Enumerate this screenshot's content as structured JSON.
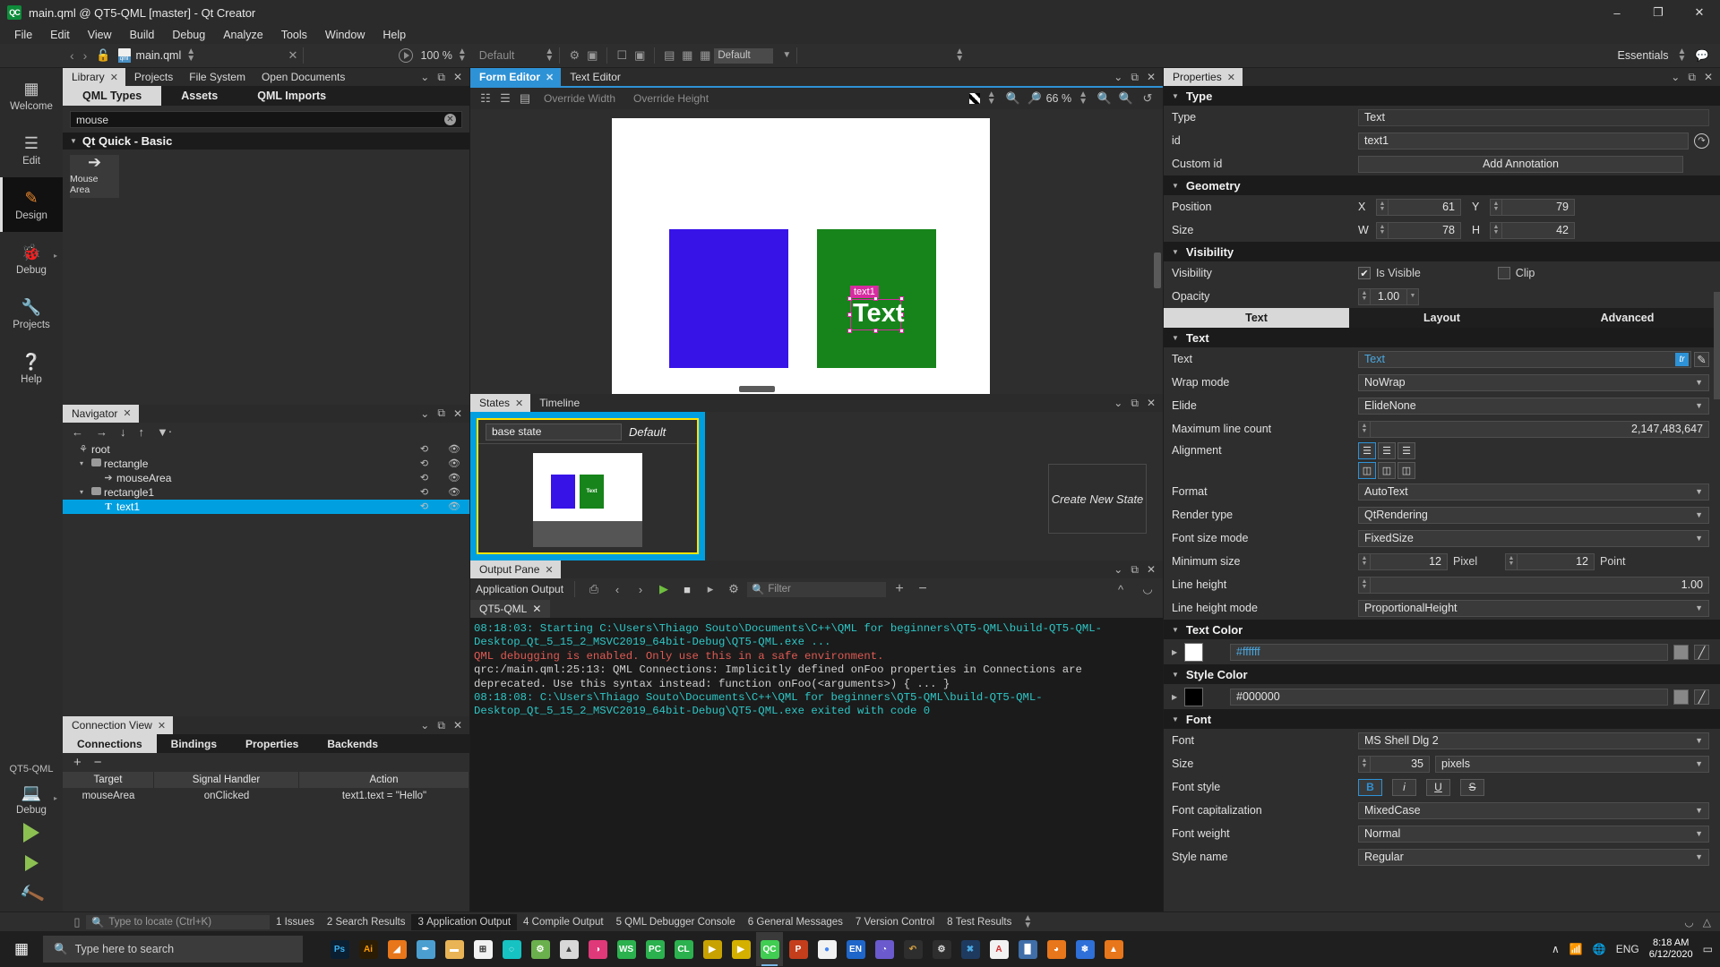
{
  "window": {
    "title": "main.qml @ QT5-QML [master] - Qt Creator",
    "app_icon": "qt-creator-icon",
    "minimize": "–",
    "maximize": "❐",
    "close": "✕"
  },
  "menubar": {
    "items": [
      "File",
      "Edit",
      "View",
      "Build",
      "Debug",
      "Analyze",
      "Tools",
      "Window",
      "Help"
    ]
  },
  "toolbar": {
    "back": "‹",
    "forward": "›",
    "lock": "lock-open-icon",
    "filename": "main.qml",
    "close_doc": "✕",
    "run_percent": "100 %",
    "preview_default": "Default",
    "kit_default": "Default",
    "essentials": "Essentials"
  },
  "modebar": {
    "modes": [
      {
        "label": "Welcome",
        "icon": "▒",
        "active": false
      },
      {
        "label": "Edit",
        "icon": "☰",
        "active": false
      },
      {
        "label": "Design",
        "icon": "✎",
        "active": true
      },
      {
        "label": "Debug",
        "icon": "🐞",
        "active": false,
        "arrow": "▸"
      },
      {
        "label": "Projects",
        "icon": "🔧",
        "active": false
      },
      {
        "label": "Help",
        "icon": "?",
        "active": false
      }
    ],
    "kit_name": "QT5-QML",
    "build_config": "Debug",
    "build_arrow": "▸"
  },
  "library": {
    "dock_tabs": [
      {
        "label": "Library",
        "selected": true,
        "closable": true
      },
      {
        "label": "Projects",
        "selected": false
      },
      {
        "label": "File System",
        "selected": false
      },
      {
        "label": "Open Documents",
        "selected": false
      }
    ],
    "sub_tabs": [
      {
        "label": "QML Types",
        "selected": true
      },
      {
        "label": "Assets",
        "selected": false
      },
      {
        "label": "QML Imports",
        "selected": false
      }
    ],
    "search_value": "mouse",
    "clear_icon": "✕",
    "group_label": "Qt Quick - Basic",
    "items": [
      {
        "label": "Mouse Area",
        "icon": "cursor-arrow-icon"
      }
    ]
  },
  "navigator": {
    "title": "Navigator",
    "toolbar_icons": [
      "←",
      "→",
      "↓",
      "↑",
      "filter-icon"
    ],
    "rows": [
      {
        "name": "root",
        "indent": 0,
        "twisty": "",
        "icon": "component-icon",
        "selected": false
      },
      {
        "name": "rectangle",
        "indent": 1,
        "twisty": "▾",
        "icon": "rectangle-icon",
        "selected": false
      },
      {
        "name": "mouseArea",
        "indent": 2,
        "twisty": "",
        "icon": "cursor-arrow-icon",
        "selected": false
      },
      {
        "name": "rectangle1",
        "indent": 1,
        "twisty": "▾",
        "icon": "rectangle-icon",
        "selected": false
      },
      {
        "name": "text1",
        "indent": 2,
        "twisty": "",
        "icon": "text-T-icon",
        "selected": true
      }
    ]
  },
  "connection_view": {
    "title": "Connection View",
    "tabs": [
      {
        "label": "Connections",
        "selected": true
      },
      {
        "label": "Bindings",
        "selected": false
      },
      {
        "label": "Properties",
        "selected": false
      },
      {
        "label": "Backends",
        "selected": false
      }
    ],
    "add_icon": "+",
    "remove_icon": "−",
    "columns": [
      "Target",
      "Signal Handler",
      "Action"
    ],
    "rows": [
      {
        "target": "mouseArea",
        "signal_handler": "onClicked",
        "action": "text1.text = \"Hello\""
      }
    ]
  },
  "form_editor": {
    "tabs": [
      {
        "label": "Form Editor",
        "selected": true,
        "closable": true
      },
      {
        "label": "Text Editor",
        "selected": false
      }
    ],
    "override_width": "Override Width",
    "override_height": "Override Height",
    "zoom": "66 %",
    "canvas": {
      "blue_rect": "rectangle",
      "green_rect": "rectangle1",
      "selected_label": "text1",
      "text_value": "Text"
    }
  },
  "states": {
    "tabs": [
      {
        "label": "States",
        "selected": true,
        "closable": true
      },
      {
        "label": "Timeline",
        "selected": false
      }
    ],
    "state_name": "base state",
    "default_label": "Default",
    "create_new": "Create New State"
  },
  "output": {
    "title": "Output Pane",
    "pane_name": "Application Output",
    "filter_placeholder": "Filter",
    "run_tab": "QT5-QML",
    "lines": [
      {
        "color": "cyan",
        "text": "08:18:03: Starting C:\\Users\\Thiago Souto\\Documents\\C++\\QML for beginners\\QT5-QML\\build-QT5-QML-Desktop_Qt_5_15_2_MSVC2019_64bit-Debug\\QT5-QML.exe ..."
      },
      {
        "color": "red",
        "text": "QML debugging is enabled. Only use this in a safe environment."
      },
      {
        "color": "gray",
        "text": "qrc:/main.qml:25:13: QML Connections: Implicitly defined onFoo properties in Connections are deprecated. Use this syntax instead: function onFoo(<arguments>) { ... }"
      },
      {
        "color": "cyan",
        "text": "08:18:08: C:\\Users\\Thiago Souto\\Documents\\C++\\QML for beginners\\QT5-QML\\build-QT5-QML-Desktop_Qt_5_15_2_MSVC2019_64bit-Debug\\QT5-QML.exe exited with code 0"
      }
    ]
  },
  "properties": {
    "title": "Properties",
    "sections": {
      "type": {
        "header": "Type",
        "type_label": "Type",
        "type_value": "Text",
        "id_label": "id",
        "id_value": "text1",
        "custom_id_label": "Custom id",
        "add_annotation": "Add Annotation",
        "reset_icon": "reset-icon"
      },
      "geometry": {
        "header": "Geometry",
        "position_label": "Position",
        "x_label": "X",
        "x_value": "61",
        "y_label": "Y",
        "y_value": "79",
        "size_label": "Size",
        "w_label": "W",
        "w_value": "78",
        "h_label": "H",
        "h_value": "42"
      },
      "visibility": {
        "header": "Visibility",
        "visibility_label": "Visibility",
        "is_visible_label": "Is Visible",
        "is_visible_checked": "✔",
        "clip_label": "Clip",
        "clip_checked": "",
        "opacity_label": "Opacity",
        "opacity_value": "1.00"
      },
      "tabs": [
        {
          "label": "Text",
          "selected": true
        },
        {
          "label": "Layout",
          "selected": false
        },
        {
          "label": "Advanced",
          "selected": false
        }
      ],
      "text": {
        "header": "Text",
        "text_label": "Text",
        "text_value": "Text",
        "tr_badge": "tr",
        "edit_icon": "edit-icon",
        "wrap_label": "Wrap mode",
        "wrap_value": "NoWrap",
        "elide_label": "Elide",
        "elide_value": "ElideNone",
        "maxlines_label": "Maximum line count",
        "maxlines_value": "2,147,483,647",
        "alignment_label": "Alignment",
        "align_h": [
          "align-left-icon",
          "align-center-icon",
          "align-right-icon"
        ],
        "align_v": [
          "align-top-icon",
          "align-middle-icon",
          "align-bottom-icon"
        ],
        "format_label": "Format",
        "format_value": "AutoText",
        "render_label": "Render type",
        "render_value": "QtRendering",
        "fontsizemode_label": "Font size mode",
        "fontsizemode_value": "FixedSize",
        "minsize_label": "Minimum size",
        "minsize_px": "12",
        "px_unit": "Pixel",
        "minsize_pt": "12",
        "pt_unit": "Point",
        "lineheight_label": "Line height",
        "lineheight_value": "1.00",
        "lineheightmode_label": "Line height mode",
        "lineheightmode_value": "ProportionalHeight"
      },
      "text_color": {
        "header": "Text Color",
        "value": "#ffffff",
        "swatch": "#ffffff"
      },
      "style_color": {
        "header": "Style Color",
        "value": "#000000",
        "swatch": "#000000"
      },
      "font": {
        "header": "Font",
        "font_label": "Font",
        "font_value": "MS Shell Dlg 2",
        "size_label": "Size",
        "size_value": "35",
        "size_unit": "pixels",
        "fontstyle_label": "Font style",
        "style_buttons": [
          {
            "glyph": "B",
            "active": true
          },
          {
            "glyph": "i",
            "active": false
          },
          {
            "glyph": "U",
            "active": false
          },
          {
            "glyph": "S",
            "active": false
          }
        ],
        "capitalization_label": "Font capitalization",
        "capitalization_value": "MixedCase",
        "weight_label": "Font weight",
        "weight_value": "Normal",
        "stylename_label": "Style name",
        "stylename_value": "Regular"
      }
    }
  },
  "statusbar": {
    "locate_placeholder": "Type to locate (Ctrl+K)",
    "panes": [
      {
        "num": "1",
        "label": "Issues",
        "selected": false
      },
      {
        "num": "2",
        "label": "Search Results",
        "selected": false
      },
      {
        "num": "3",
        "label": "Application Output",
        "selected": true
      },
      {
        "num": "4",
        "label": "Compile Output",
        "selected": false
      },
      {
        "num": "5",
        "label": "QML Debugger Console",
        "selected": false
      },
      {
        "num": "6",
        "label": "General Messages",
        "selected": false
      },
      {
        "num": "7",
        "label": "Version Control",
        "selected": false
      },
      {
        "num": "8",
        "label": "Test Results",
        "selected": false
      }
    ]
  },
  "taskbar": {
    "search_placeholder": "Type here to search",
    "apps": [
      {
        "name": "photoshop",
        "glyph": "Ps",
        "bg": "#0b1f33",
        "fg": "#3ab0f0",
        "active": false
      },
      {
        "name": "illustrator",
        "glyph": "Ai",
        "bg": "#2b1d05",
        "fg": "#ff9a00",
        "active": false
      },
      {
        "name": "blender",
        "glyph": "◢",
        "bg": "#e8761a",
        "fg": "#fff",
        "active": false
      },
      {
        "name": "knife",
        "glyph": "✒",
        "bg": "#4b9fd0",
        "fg": "#fff",
        "active": false
      },
      {
        "name": "explorer",
        "glyph": "▬",
        "bg": "#e8b455",
        "fg": "#fff",
        "active": false
      },
      {
        "name": "calculator",
        "glyph": "⊞",
        "bg": "#f2f2f2",
        "fg": "#333",
        "active": false
      },
      {
        "name": "globe",
        "glyph": "◌",
        "bg": "#16c2c2",
        "fg": "#fff",
        "active": false
      },
      {
        "name": "android",
        "glyph": "⚙",
        "bg": "#6ab04c",
        "fg": "#fff",
        "active": false
      },
      {
        "name": "rocket",
        "glyph": "▲",
        "bg": "#d8d8d8",
        "fg": "#444",
        "active": false
      },
      {
        "name": "audacity",
        "glyph": "◑",
        "bg": "#e0397a",
        "fg": "#fff",
        "active": false
      },
      {
        "name": "ws",
        "glyph": "WS",
        "bg": "#2bb14e",
        "fg": "#fff",
        "active": false
      },
      {
        "name": "pc",
        "glyph": "PC",
        "bg": "#2bb14e",
        "fg": "#fff",
        "active": false
      },
      {
        "name": "cl",
        "glyph": "CL",
        "bg": "#2bb14e",
        "fg": "#fff",
        "active": false
      },
      {
        "name": "yellow1",
        "glyph": "▶",
        "bg": "#c8a200",
        "fg": "#fff",
        "active": false
      },
      {
        "name": "yellow2",
        "glyph": "▶",
        "bg": "#d4b000",
        "fg": "#fff",
        "active": false
      },
      {
        "name": "qtcreator",
        "glyph": "QC",
        "bg": "#41cd52",
        "fg": "#fff",
        "active": true
      },
      {
        "name": "powerpoint",
        "glyph": "P",
        "bg": "#c43e1c",
        "fg": "#fff",
        "active": false
      },
      {
        "name": "chrome",
        "glyph": "●",
        "bg": "#f2f2f2",
        "fg": "#4285f4",
        "active": false
      },
      {
        "name": "evernote",
        "glyph": "EN",
        "bg": "#1e66c9",
        "fg": "#fff",
        "active": false
      },
      {
        "name": "gimp",
        "glyph": "◔",
        "bg": "#6a5acd",
        "fg": "#fff",
        "active": false
      },
      {
        "name": "curl",
        "glyph": "↶",
        "bg": "#2e2e2e",
        "fg": "#d4a040",
        "active": false
      },
      {
        "name": "settings",
        "glyph": "⚙",
        "bg": "#2e2e2e",
        "fg": "#e0e0e0",
        "active": false
      },
      {
        "name": "vscode",
        "glyph": "✖",
        "bg": "#1e3a5f",
        "fg": "#4aa8e0",
        "active": false
      },
      {
        "name": "acrobat",
        "glyph": "A",
        "bg": "#f2f2f2",
        "fg": "#d32f2f",
        "active": false
      },
      {
        "name": "charts",
        "glyph": "█",
        "bg": "#3f6ea8",
        "fg": "#fff",
        "active": false
      },
      {
        "name": "firefox",
        "glyph": "◕",
        "bg": "#e8761a",
        "fg": "#fff",
        "active": false
      },
      {
        "name": "fish",
        "glyph": "❄",
        "bg": "#2e6fd8",
        "fg": "#fff",
        "active": false
      },
      {
        "name": "vlc",
        "glyph": "▲",
        "bg": "#e8761a",
        "fg": "#fff",
        "active": false
      }
    ],
    "tray_chevron": "∧",
    "tray_icons": [
      "network-icon",
      "sound-icon"
    ],
    "language": "ENG",
    "time": "8:18 AM",
    "date": "6/12/2020",
    "notification": "▭"
  }
}
